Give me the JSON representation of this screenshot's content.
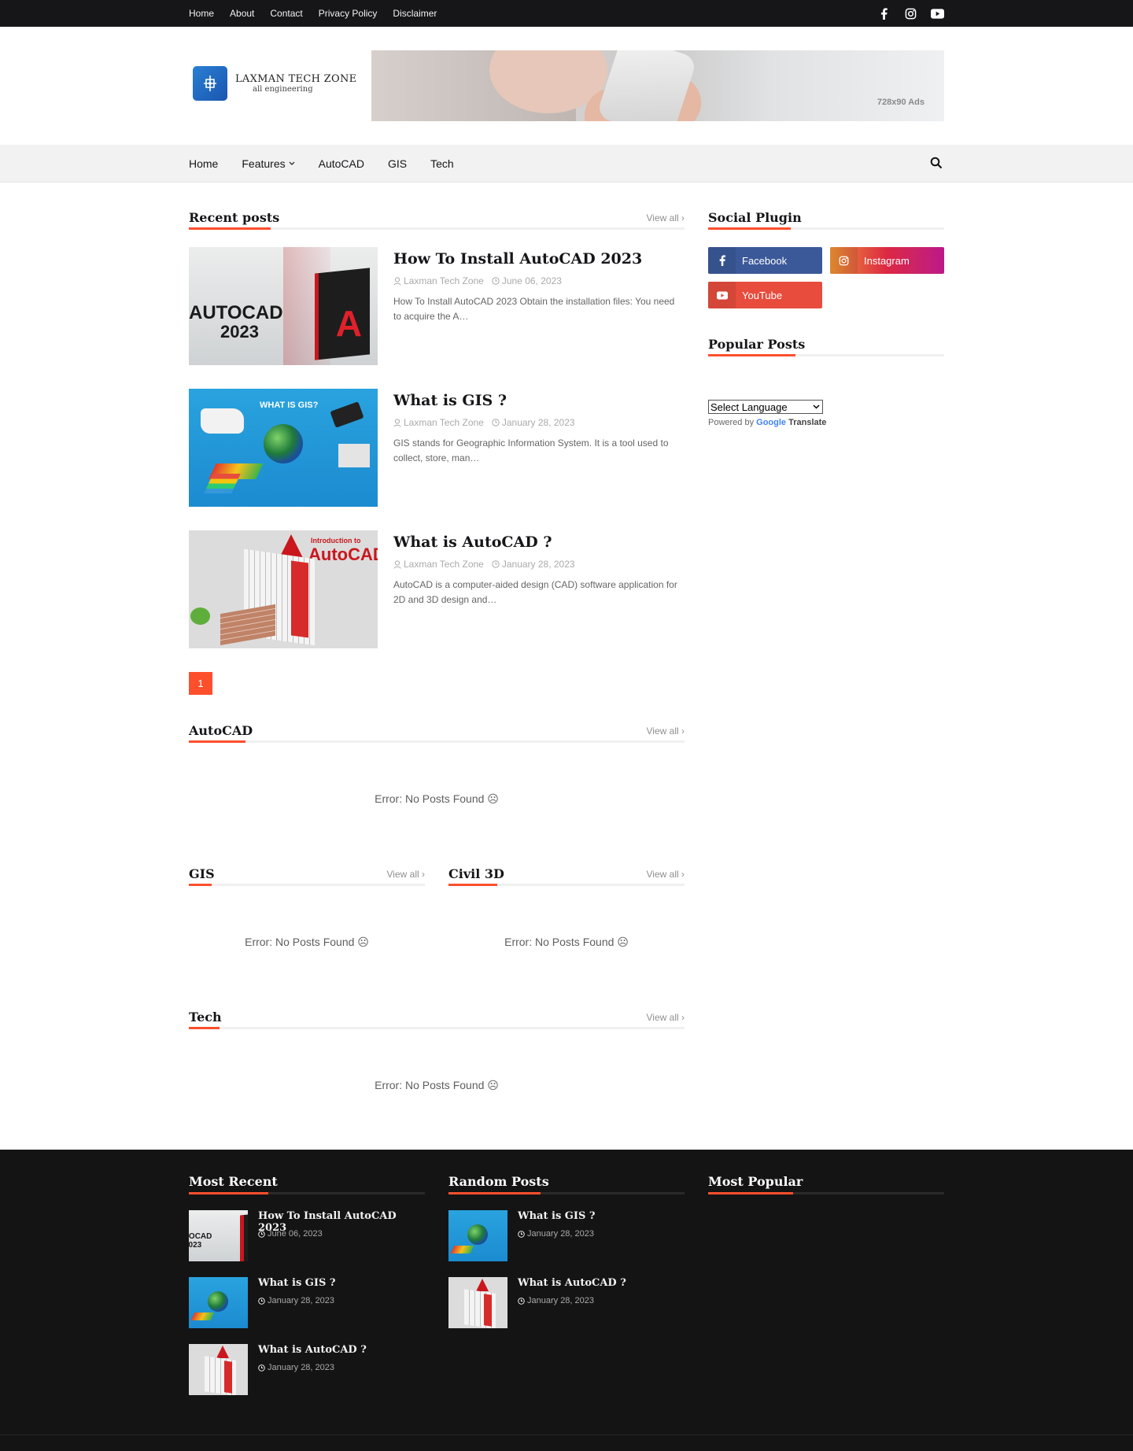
{
  "topbar": {
    "links": [
      "Home",
      "About",
      "Contact",
      "Privacy Policy",
      "Disclaimer"
    ],
    "social_icons": [
      "facebook-icon",
      "instagram-icon",
      "youtube-icon"
    ]
  },
  "header": {
    "logo_title": "LAXMAN TECH ZONE",
    "logo_tagline": "all engineering",
    "ad_label": "728x90 Ads"
  },
  "mainnav": {
    "items": [
      "Home",
      "Features",
      "AutoCAD",
      "GIS",
      "Tech"
    ]
  },
  "recent": {
    "title": "Recent posts",
    "view_all": "View all",
    "posts": [
      {
        "title": "How To Install AutoCAD 2023",
        "author": "Laxman Tech Zone",
        "date": "June 06, 2023",
        "snippet": "How To Install AutoCAD 2023 Obtain the installation files: You need to acquire the A…",
        "thumb_text": [
          "AUTOCAD",
          "2023"
        ]
      },
      {
        "title": "What is GIS ?",
        "author": "Laxman Tech Zone",
        "date": "January 28, 2023",
        "snippet": "GIS stands for Geographic Information System. It is a tool used to collect, store, man…",
        "thumb_text": [
          "WHAT IS GIS?"
        ]
      },
      {
        "title": "What is AutoCAD ?",
        "author": "Laxman Tech Zone",
        "date": "January 28, 2023",
        "snippet": "AutoCAD is a computer-aided design (CAD) software application for 2D and 3D design and…",
        "thumb_text": [
          "Introduction to",
          "AutoCAD"
        ]
      }
    ],
    "page": "1"
  },
  "sections": {
    "autocad": {
      "title": "AutoCAD",
      "view_all": "View all",
      "empty": "Error: No Posts Found ☹"
    },
    "gis": {
      "title": "GIS",
      "view_all": "View all",
      "empty": "Error: No Posts Found ☹"
    },
    "civil3d": {
      "title": "Civil 3D",
      "view_all": "View all",
      "empty": "Error: No Posts Found ☹"
    },
    "tech": {
      "title": "Tech",
      "view_all": "View all",
      "empty": "Error: No Posts Found ☹"
    }
  },
  "sidebar": {
    "social_title": "Social Plugin",
    "social_buttons": [
      {
        "label": "Facebook",
        "color": "#3b5999"
      },
      {
        "label": "Instagram",
        "color": "#d6249f"
      },
      {
        "label": "YouTube",
        "color": "#f50000"
      }
    ],
    "popular_title": "Popular Posts",
    "language_select": "Select Language",
    "powered_by": "Powered by",
    "google": "Google",
    "translate": "Translate"
  },
  "footer": {
    "most_recent": {
      "title": "Most Recent",
      "posts": [
        {
          "title": "How To Install AutoCAD 2023",
          "date": "June 06, 2023"
        },
        {
          "title": "What is GIS ?",
          "date": "January 28, 2023"
        },
        {
          "title": "What is AutoCAD ?",
          "date": "January 28, 2023"
        }
      ]
    },
    "random": {
      "title": "Random Posts",
      "posts": [
        {
          "title": "What is GIS ?",
          "date": "January 28, 2023"
        },
        {
          "title": "What is AutoCAD ?",
          "date": "January 28, 2023"
        }
      ]
    },
    "popular": {
      "title": "Most Popular"
    }
  },
  "colors": {
    "accent": "#fe4f2d",
    "dark": "#141414"
  }
}
